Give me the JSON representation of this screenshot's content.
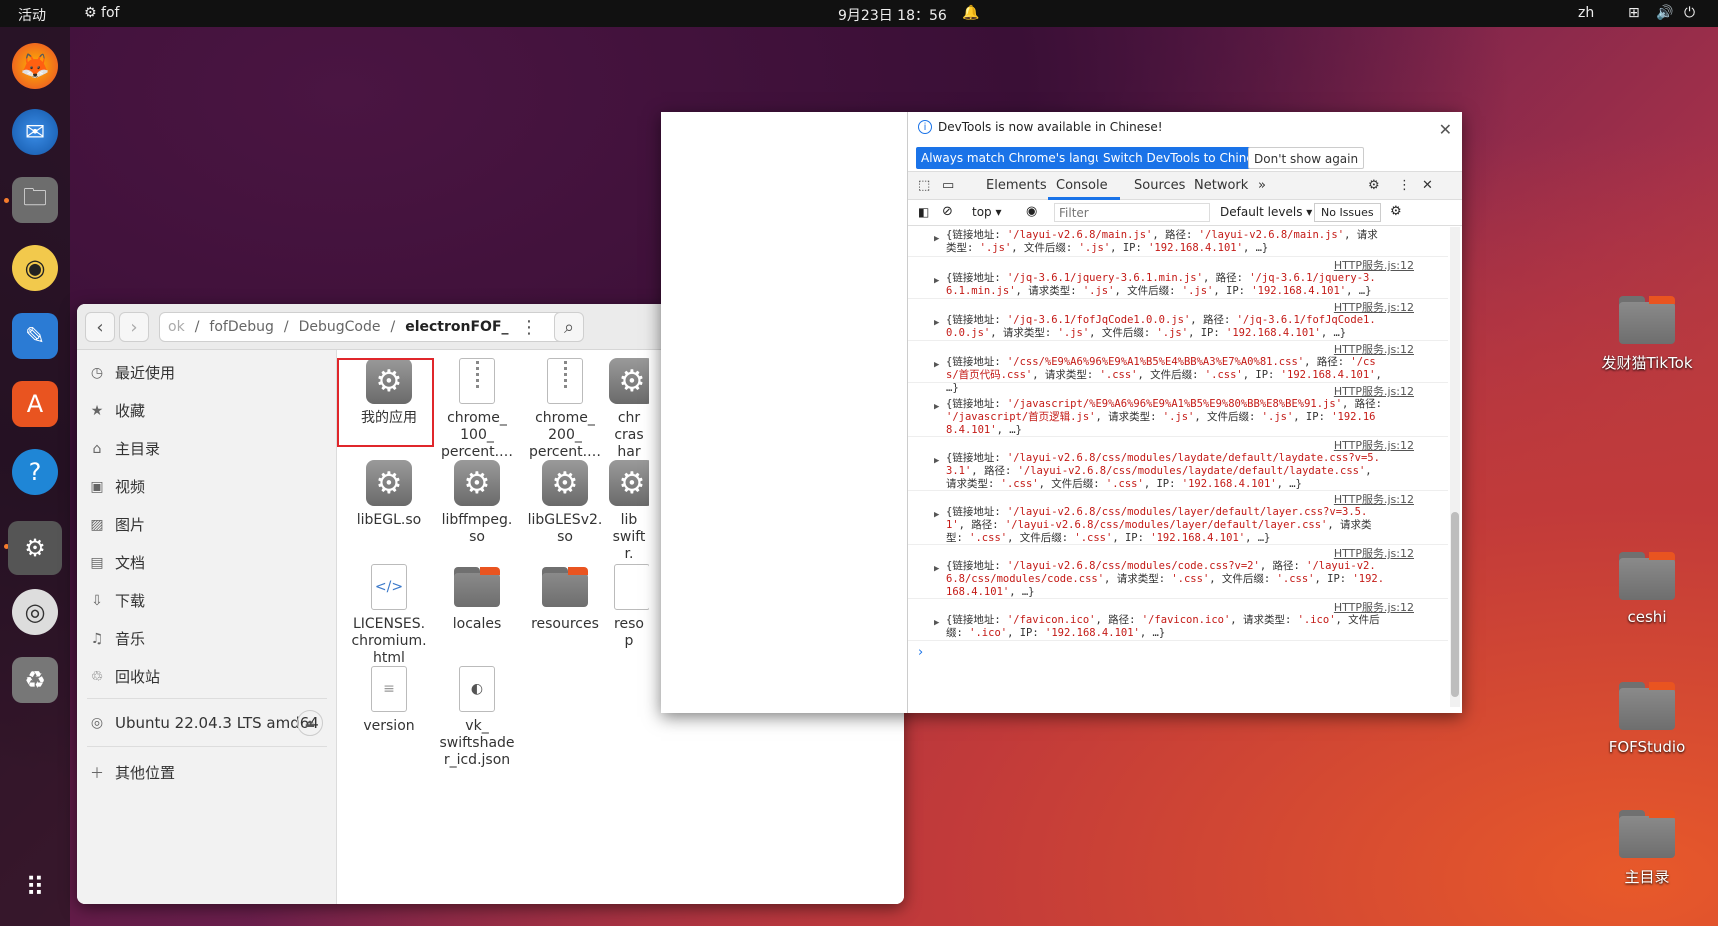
{
  "topbar": {
    "activities": "活动",
    "app": "fof",
    "clock": "9月23日 18：56",
    "lang": "zh"
  },
  "desktop": [
    {
      "label": "发财猫TikTok"
    },
    {
      "label": "ceshi"
    },
    {
      "label": "FOFStudio"
    },
    {
      "label": "主目录"
    }
  ],
  "files": {
    "path": [
      "ok",
      "fofDebug",
      "DebugCode",
      "electronFOF_"
    ],
    "sidebar": {
      "recent": "最近使用",
      "starred": "收藏",
      "home": "主目录",
      "videos": "视频",
      "pictures": "图片",
      "documents": "文档",
      "downloads": "下载",
      "music": "音乐",
      "trash": "回收站",
      "volume": "Ubuntu 22.04.3 LTS amd64",
      "other": "其他位置"
    },
    "items": [
      {
        "name": "我的应用",
        "type": "gear"
      },
      {
        "name": "chrome_ 100_ percent.…",
        "type": "zip"
      },
      {
        "name": "chrome_ 200_ percent.…",
        "type": "zip"
      },
      {
        "name": "chr cras har",
        "type": "gear"
      },
      {
        "name": "libEGL.so",
        "type": "gear"
      },
      {
        "name": "libffmpeg. so",
        "type": "gear"
      },
      {
        "name": "libGLESv2. so",
        "type": "gear"
      },
      {
        "name": "lib swift r.",
        "type": "gear"
      },
      {
        "name": "LICENSES. chromium. html",
        "type": "html"
      },
      {
        "name": "locales",
        "type": "folder"
      },
      {
        "name": "resources",
        "type": "folder"
      },
      {
        "name": "reso p",
        "type": "doc"
      },
      {
        "name": "version",
        "type": "doc"
      },
      {
        "name": "vk_ swiftshade r_icd.json",
        "type": "json"
      }
    ]
  },
  "devtools": {
    "notice": "DevTools is now available in Chinese!",
    "btn_match": "Always match Chrome's language",
    "btn_switch": "Switch DevTools to Chinese",
    "btn_dont": "Don't show again",
    "tabs": [
      "Elements",
      "Console",
      "Sources",
      "Network"
    ],
    "toolbar": {
      "context": "top",
      "filter_placeholder": "Filter",
      "levels": "Default levels",
      "issues": "No Issues"
    },
    "source": "HTTP服务.js:12",
    "logs": [
      "{链接地址: '/layui-v2.6.8/main.js', 路径: '/layui-v2.6.8/main.js', 请求类型: '.js', 文件后缀: '.js', IP: '192.168.4.101', …}",
      "{链接地址: '/jq-3.6.1/jquery-3.6.1.min.js', 路径: '/jq-3.6.1/jquery-3.6.1.min.js', 请求类型: '.js', 文件后缀: '.js', IP: '192.168.4.101', …}",
      "{链接地址: '/jq-3.6.1/fofJqCode1.0.0.js', 路径: '/jq-3.6.1/fofJqCode1.0.0.js', 请求类型: '.js', 文件后缀: '.js', IP: '192.168.4.101', …}",
      "{链接地址: '/css/%E9%A6%96%E9%A1%B5%E4%BB%A3%E7%A0%81.css', 路径: '/css/首页代码.css', 请求类型: '.css', 文件后缀: '.css', IP: '192.168.4.101', …}",
      "{链接地址: '/javascript/%E9%A6%96%E9%A1%B5%E9%80%BB%E8%BE%91.js', 路径: '/javascript/首页逻辑.js', 请求类型: '.js', 文件后缀: '.js', IP: '192.168.4.101', …}",
      "{链接地址: '/layui-v2.6.8/css/modules/laydate/default/laydate.css?v=5.3.1', 路径: '/layui-v2.6.8/css/modules/laydate/default/laydate.css', 请求类型: '.css', 文件后缀: '.css', IP: '192.168.4.101', …}",
      "{链接地址: '/layui-v2.6.8/css/modules/layer/default/layer.css?v=3.5.1', 路径: '/layui-v2.6.8/css/modules/layer/default/layer.css', 请求类型: '.css', 文件后缀: '.css', IP: '192.168.4.101', …}",
      "{链接地址: '/layui-v2.6.8/css/modules/code.css?v=2', 路径: '/layui-v2.6.8/css/modules/code.css', 请求类型: '.css', 文件后缀: '.css', IP: '192.168.4.101', …}",
      "{链接地址: '/favicon.ico', 路径: '/favicon.ico', 请求类型: '.ico', 文件后缀: '.ico', IP: '192.168.4.101', …}"
    ]
  }
}
